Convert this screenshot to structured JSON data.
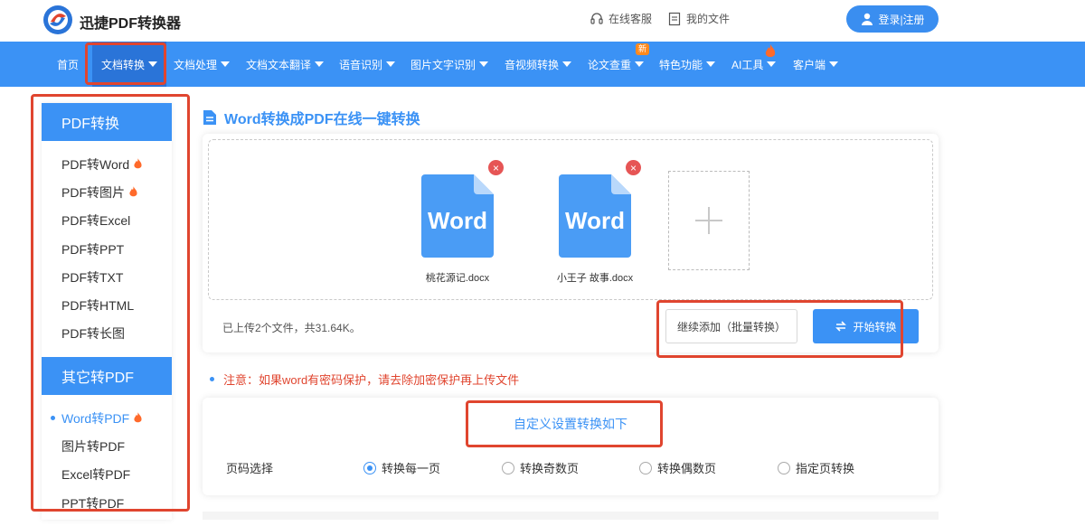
{
  "header": {
    "brand": "迅捷PDF转换器",
    "service_label": "在线客服",
    "files_label": "我的文件",
    "login_label": "登录|注册"
  },
  "nav": {
    "items": [
      {
        "label": "首页"
      },
      {
        "label": "文档转换"
      },
      {
        "label": "文档处理"
      },
      {
        "label": "文档文本翻译"
      },
      {
        "label": "语音识别"
      },
      {
        "label": "图片文字识别"
      },
      {
        "label": "音视频转换"
      },
      {
        "label": "论文查重"
      },
      {
        "label": "特色功能"
      },
      {
        "label": "AI工具"
      },
      {
        "label": "客户端"
      }
    ],
    "new_badge": "新"
  },
  "sidebar": {
    "section1_title": "PDF转换",
    "section1_items": [
      {
        "label": "PDF转Word"
      },
      {
        "label": "PDF转图片"
      },
      {
        "label": "PDF转Excel"
      },
      {
        "label": "PDF转PPT"
      },
      {
        "label": "PDF转TXT"
      },
      {
        "label": "PDF转HTML"
      },
      {
        "label": "PDF转长图"
      }
    ],
    "section2_title": "其它转PDF",
    "section2_items": [
      {
        "label": "Word转PDF"
      },
      {
        "label": "图片转PDF"
      },
      {
        "label": "Excel转PDF"
      },
      {
        "label": "PPT转PDF"
      }
    ]
  },
  "main": {
    "title": "Word转换成PDF在线一键转换",
    "files": [
      {
        "icon_text": "Word",
        "name": "桃花源记.docx"
      },
      {
        "icon_text": "Word",
        "name": "小王子 故事.docx"
      }
    ],
    "status": "已上传2个文件，共31.64K。",
    "add_more_label": "继续添加（批量转换）",
    "start_label": "开始转换",
    "notice": "注意：如果word有密码保护，请去除加密保护再上传文件",
    "settings_title": "自定义设置转换如下",
    "page_select_label": "页码选择",
    "page_options": [
      {
        "label": "转换每一页",
        "checked": true
      },
      {
        "label": "转换奇数页",
        "checked": false
      },
      {
        "label": "转换偶数页",
        "checked": false
      },
      {
        "label": "指定页转换",
        "checked": false
      }
    ]
  },
  "colors": {
    "primary": "#3b92f5",
    "highlight": "#e0452f",
    "fire": "#ff6a2b"
  }
}
